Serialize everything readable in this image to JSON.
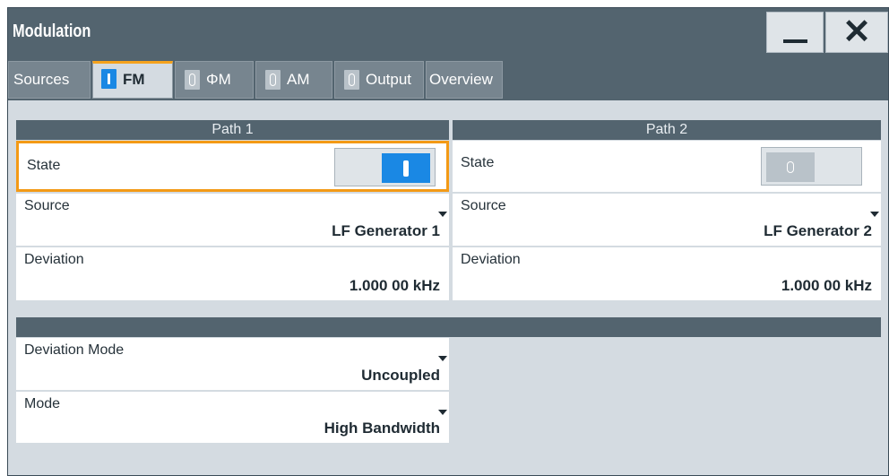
{
  "window": {
    "title": "Modulation",
    "minimize_icon": "minimize-icon",
    "close_icon": "close-icon",
    "close_glyph": "✕"
  },
  "tabs": [
    {
      "label": "Sources",
      "active": false,
      "indicator": null
    },
    {
      "label": "FM",
      "active": true,
      "indicator": "on"
    },
    {
      "label": "ΦM",
      "active": false,
      "indicator": "off"
    },
    {
      "label": "AM",
      "active": false,
      "indicator": "off"
    },
    {
      "label": "Output",
      "active": false,
      "indicator": "off"
    },
    {
      "label": "Overview",
      "active": false,
      "indicator": null
    }
  ],
  "path1": {
    "header": "Path 1",
    "state_label": "State",
    "state": "on",
    "source_label": "Source",
    "source_value": "LF Generator 1",
    "deviation_label": "Deviation",
    "deviation_value": "1.000 00 kHz"
  },
  "path2": {
    "header": "Path 2",
    "state_label": "State",
    "state": "off",
    "source_label": "Source",
    "source_value": "LF Generator 2",
    "deviation_label": "Deviation",
    "deviation_value": "1.000 00 kHz"
  },
  "settings": {
    "header": "",
    "deviation_mode_label": "Deviation Mode",
    "deviation_mode_value": "Uncoupled",
    "mode_label": "Mode",
    "mode_value": "High Bandwidth"
  },
  "colors": {
    "titlebar": "#53646f",
    "accent_blue": "#1a88e4",
    "focus_orange": "#f39a16",
    "panel_bg": "#d4dbe1"
  }
}
